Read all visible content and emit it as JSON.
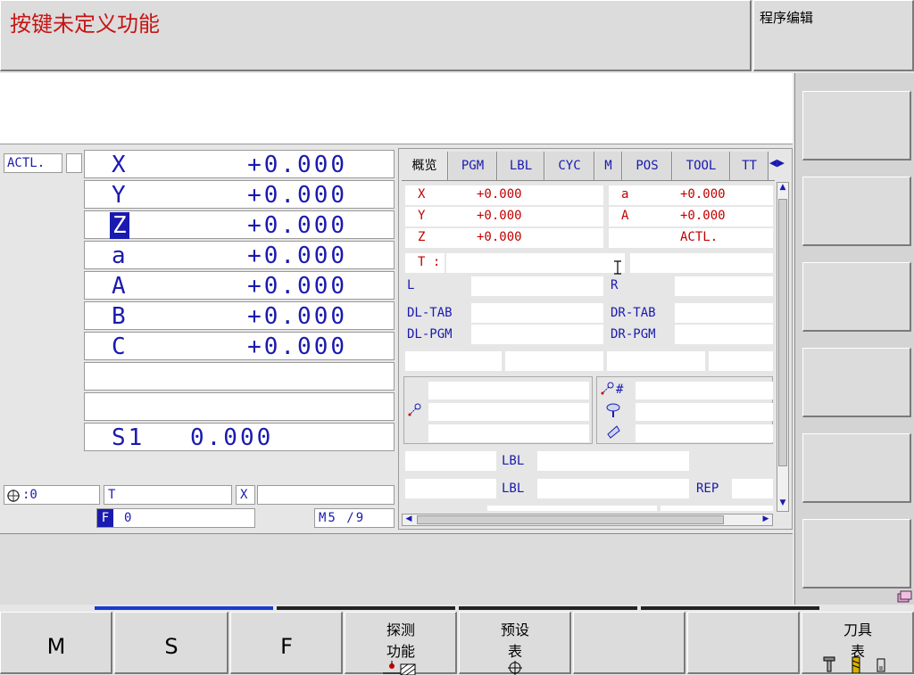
{
  "header": {
    "message": "按键未定义功能",
    "mode": "程序编辑"
  },
  "position": {
    "mode_label": "ACTL.",
    "axes": [
      {
        "name": "X",
        "value": "+0.000"
      },
      {
        "name": "Y",
        "value": "+0.000"
      },
      {
        "name": "Z",
        "value": "+0.000"
      },
      {
        "name": "a",
        "value": "+0.000"
      },
      {
        "name": "A",
        "value": "+0.000"
      },
      {
        "name": "B",
        "value": "+0.000"
      },
      {
        "name": "C",
        "value": "+0.000"
      }
    ],
    "spindle": {
      "label": "S1",
      "value": "0.000"
    },
    "datum": ":0",
    "tool_label": "T",
    "axis_x_label": "X",
    "feed_label": "F",
    "feed_value": "0",
    "mfunc": "M5 /9"
  },
  "status_tabs": [
    "概览",
    "PGM",
    "LBL",
    "CYC",
    "M",
    "POS",
    "TOOL",
    "TT"
  ],
  "overview": {
    "left_axes": [
      {
        "name": "X",
        "value": "+0.000"
      },
      {
        "name": "Y",
        "value": "+0.000"
      },
      {
        "name": "Z",
        "value": "+0.000"
      }
    ],
    "right_axes": [
      {
        "name": "a",
        "value": "+0.000"
      },
      {
        "name": "A",
        "value": "+0.000"
      }
    ],
    "mode": "ACTL.",
    "tool_t": "T :",
    "l_label": "L",
    "r_label": "R",
    "dl_tab": "DL-TAB",
    "dr_tab": "DR-TAB",
    "dl_pgm": "DL-PGM",
    "dr_pgm": "DR-PGM",
    "hash": "#",
    "lbl1": "LBL",
    "lbl2": "LBL",
    "rep": "REP"
  },
  "softkeys": [
    {
      "label": "M"
    },
    {
      "label": "S"
    },
    {
      "label": "F"
    },
    {
      "line1": "探测",
      "line2": "功能"
    },
    {
      "line1": "预设",
      "line2": "表"
    },
    {
      "line1": "",
      "line2": ""
    },
    {
      "line1": "",
      "line2": ""
    },
    {
      "line1": "刀具",
      "line2": "表"
    }
  ]
}
